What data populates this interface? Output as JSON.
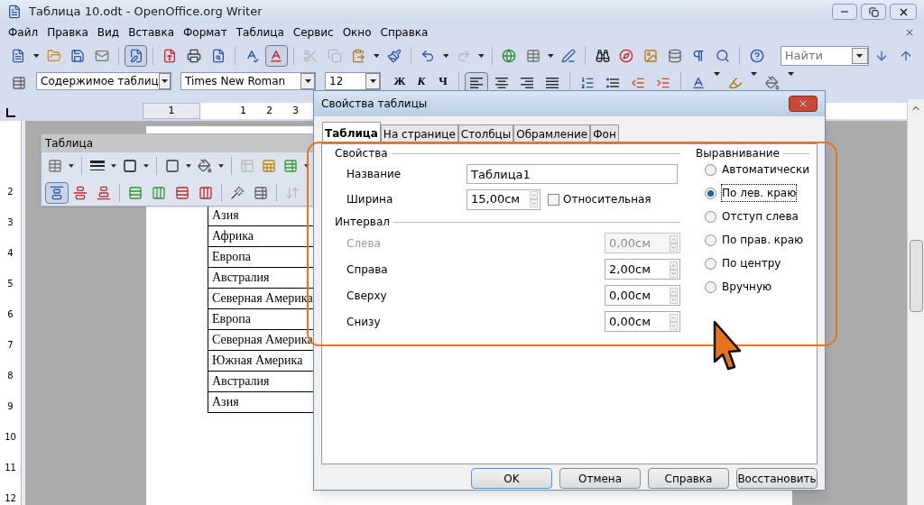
{
  "window": {
    "title": "Таблица 10.odt - OpenOffice.org Writer"
  },
  "menu": [
    "Файл",
    "Правка",
    "Вид",
    "Вставка",
    "Формат",
    "Таблица",
    "Сервис",
    "Окно",
    "Справка"
  ],
  "standard_toolbar": {
    "edit_mode_pressed": true,
    "autospell_pressed": true
  },
  "find_toolbar": {
    "placeholder": "Найти"
  },
  "formatting_toolbar": {
    "style": "Содержимое таблиц",
    "font": "Times New Roman",
    "size": "12",
    "bold": "Ж",
    "italic": "К",
    "underline": "Ч",
    "alignment": [
      {
        "selected": true
      },
      {
        "selected": false
      },
      {
        "selected": false
      },
      {
        "selected": false
      }
    ]
  },
  "ruler": {
    "horizontal": [
      "1",
      "1",
      "2",
      "3"
    ],
    "vertical": [
      "2",
      "3",
      "4",
      "5",
      "6",
      "7",
      "8",
      "9",
      "10",
      "11",
      "12"
    ]
  },
  "table_toolbar": {
    "title": "Таблица",
    "align_top_pressed": true
  },
  "document_table": {
    "rows": [
      "Азия",
      "Африка",
      "Европа",
      "Австралия",
      "Северная Америка",
      "Европа",
      "Северная Америка",
      "Южная Америка",
      "Австралия",
      "Азия"
    ]
  },
  "dialog": {
    "title": "Свойства таблицы",
    "tabs": [
      {
        "label": "Таблица",
        "selected": true
      },
      {
        "label": "На странице",
        "selected": false
      },
      {
        "label": "Столбцы",
        "selected": false
      },
      {
        "label": "Обрамление",
        "selected": false
      },
      {
        "label": "Фон",
        "selected": false
      }
    ],
    "properties": {
      "heading": "Свойства",
      "name": {
        "label": "Название",
        "value": "Таблица1"
      },
      "width": {
        "label": "Ширина",
        "value": "15,00см"
      },
      "relative": {
        "label": "Относительная",
        "checked": false
      }
    },
    "spacing": {
      "heading": "Интервал",
      "fields": [
        {
          "label": "Слева",
          "value": "0,00см",
          "disabled": true
        },
        {
          "label": "Справа",
          "value": "2,00см",
          "disabled": false
        },
        {
          "label": "Сверху",
          "value": "0,00см",
          "disabled": false
        },
        {
          "label": "Снизу",
          "value": "0,00см",
          "disabled": false
        }
      ]
    },
    "alignment": {
      "heading": "Выравнивание",
      "options": [
        {
          "label": "Автоматически",
          "selected": false
        },
        {
          "label": "По лев. краю",
          "selected": true
        },
        {
          "label": "Отступ слева",
          "selected": false
        },
        {
          "label": "По прав. краю",
          "selected": false
        },
        {
          "label": "По центру",
          "selected": false
        },
        {
          "label": "Вручную",
          "selected": false
        }
      ]
    },
    "buttons": [
      {
        "label": "OK",
        "default": true
      },
      {
        "label": "Отмена",
        "default": false
      },
      {
        "label": "Справка",
        "default": false
      },
      {
        "label": "Восстановить",
        "default": false
      }
    ]
  }
}
